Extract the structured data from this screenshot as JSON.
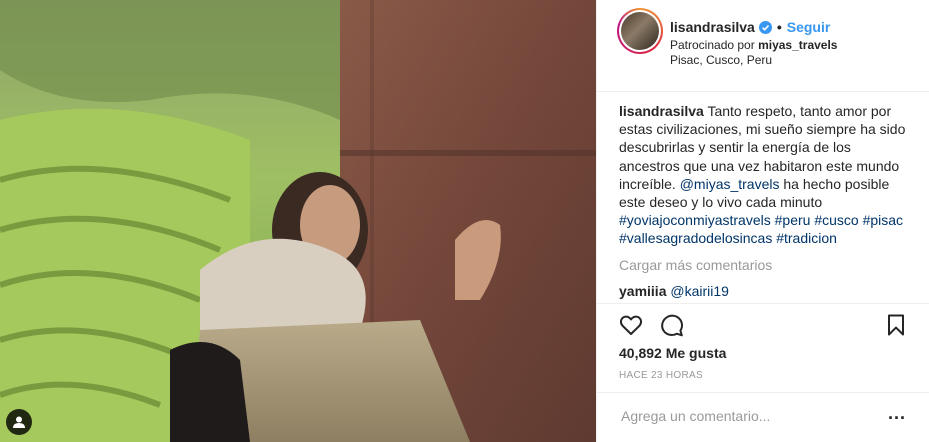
{
  "post": {
    "username": "lisandrasilva",
    "follow_label": "Seguir",
    "dot": "•",
    "sponsored_prefix": "Patrocinado por",
    "sponsor": "miyas_travels",
    "location": "Pisac, Cusco, Peru",
    "caption_user": "lisandrasilva",
    "caption_text": "Tanto respeto, tanto amor por estas civilizaciones, mi sueño siempre ha sido descubrirlas y sentir la energía de los ancestros que una vez habitaron este mundo increíble.",
    "caption_mention": "@miyas_travels",
    "caption_text2": "ha hecho posible este deseo y lo vivo cada minuto",
    "hashtags": [
      "#yoviajoconmiyastravels",
      "#peru",
      "#cusco",
      "#pisac",
      "#vallesagradodelosincas",
      "#tradicion"
    ],
    "load_more": "Cargar más comentarios",
    "comment_user": "yamiiia",
    "comment_mention": "@kairii19",
    "likes": "40,892 Me gusta",
    "timestamp": "HACE 23 HORAS",
    "comment_placeholder": "Agrega un comentario...",
    "more": "..."
  },
  "icons": [
    "verified-badge-icon",
    "heart-icon",
    "comment-icon",
    "bookmark-icon",
    "user-tag-icon"
  ],
  "colors": {
    "link": "#003569",
    "follow": "#3897f0",
    "muted": "#999999",
    "text": "#262626",
    "border": "#efefef"
  }
}
